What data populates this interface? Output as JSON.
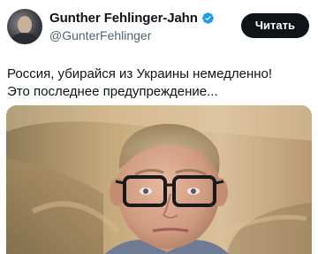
{
  "post": {
    "author": {
      "display_name": "Gunther Fehlinger-Jahn",
      "handle": "@GunterFehlinger",
      "verified_icon": "verified-badge-icon",
      "verified_color": "#1d9bf0"
    },
    "follow_label": "Читать",
    "text_lines": [
      "Россия, убирайся из Украины немедленно!",
      "Это последнее предупреждение..."
    ]
  },
  "colors": {
    "follow_button_bg": "#0f1419",
    "handle_gray": "#536471"
  }
}
